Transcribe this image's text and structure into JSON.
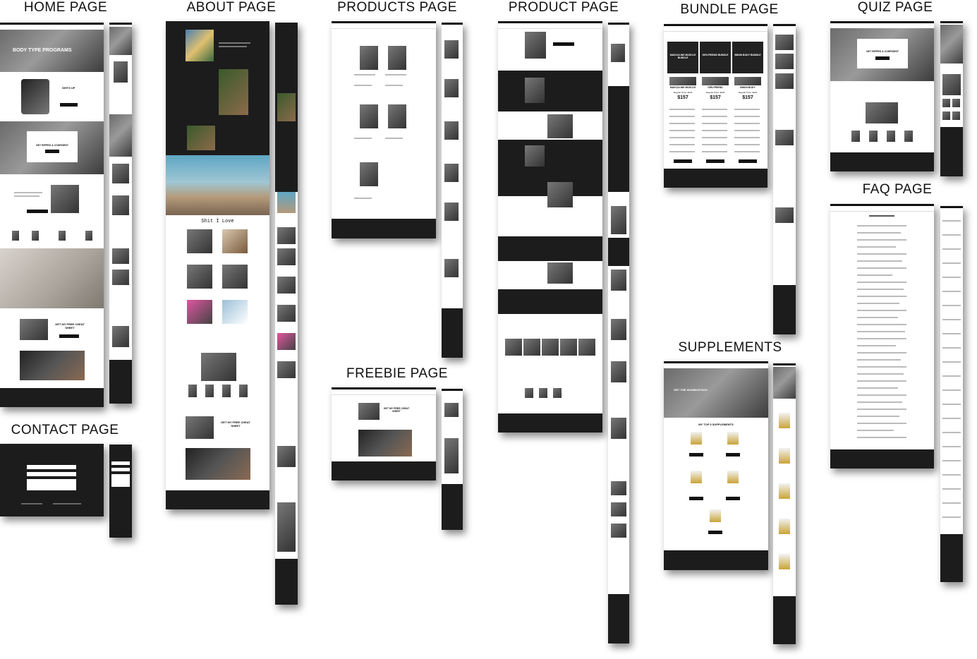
{
  "labels": {
    "home": "HOME PAGE",
    "about": "ABOUT PAGE",
    "products": "PRODUCTS PAGE",
    "product": "PRODUCT PAGE",
    "bundle": "BUNDLE PAGE",
    "quiz": "QUIZ PAGE",
    "faq": "FAQ PAGE",
    "contact": "CONTACT PAGE",
    "freebie": "FREEBIE PAGE",
    "supplements": "SUPPLEMENTS"
  },
  "home": {
    "hero_title": "BODY TYPE PROGRAMS",
    "app_title": "SHITS UP",
    "quiz_cta": "GET RIPPED & CONFIDENT",
    "freebie_title": "GET MY FREE CHEAT SHEET"
  },
  "about": {
    "love_title": "Shit I Love",
    "freebie_title": "GET MY FREE CHEAT SHEET"
  },
  "bundle": {
    "titles": [
      "MASCULINE MUSCLE BUNDLE",
      "GIRLFRIEND BUNDLE",
      "BIKINI BODY BUNDLE"
    ],
    "cards": [
      {
        "name": "MASCULINE MUSCLE",
        "regular": "Regular Price: $226",
        "price": "$157"
      },
      {
        "name": "GIRLFRIEND",
        "regular": "Regular Price: $226",
        "price": "$157"
      },
      {
        "name": "BIKINI BODY",
        "regular": "Regular Price: $226",
        "price": "$157"
      }
    ]
  },
  "quiz": {
    "cta": "GET RIPPED & CONFIDENT"
  },
  "freebie": {
    "title": "GET MY FREE CHEAT SHEET"
  },
  "supplements": {
    "hero": "GET THE WOMBOSTACK",
    "section": "MY TOP 5 SUPPLEMENTS"
  },
  "colors": {
    "dark": "#1c1c1c",
    "black": "#111111",
    "white": "#ffffff"
  }
}
